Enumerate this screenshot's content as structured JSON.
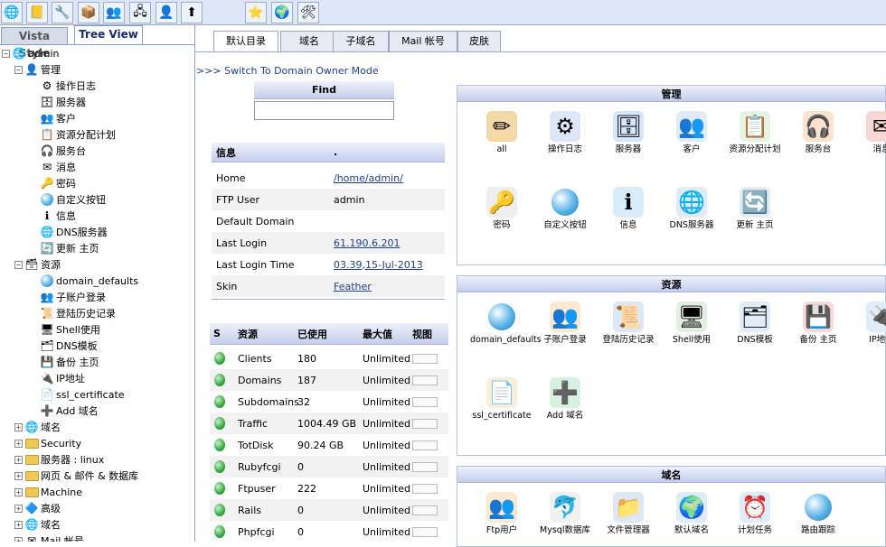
{
  "toolbar": {
    "icons": [
      "globe-person-icon",
      "notebook-icon",
      "wrench-icon",
      "cube-icon",
      "users-icon",
      "network-icon",
      "person-icon",
      "upload-icon",
      "star-icon",
      "earth-icon",
      "tools-icon"
    ]
  },
  "left": {
    "tab_vista": "Vista Style",
    "tab_tree": "Tree View",
    "tree": {
      "admin": "admin",
      "manage": "管理",
      "manage_items": [
        "操作日志",
        "服务器",
        "客户",
        "资源分配计划",
        "服务台",
        "消息",
        "密码",
        "自定义按钮",
        "信息",
        "DNS服务器",
        "更新 主页"
      ],
      "resources": "资源",
      "resource_items": [
        "domain_defaults",
        "子账户登录",
        "登陆历史记录",
        "Shell使用",
        "DNS模板",
        "备份 主页",
        "IP地址",
        "ssl_certificate",
        "Add 域名"
      ],
      "roots": [
        "域名",
        "Security",
        "服务器 : linux",
        "网页 & 邮件 & 数据库",
        "Machine",
        "高级",
        "域名",
        "Mail 帐号"
      ]
    }
  },
  "tabs": [
    "默认目录",
    "域名",
    "子域名",
    "Mail 帐号",
    "皮肤"
  ],
  "switch_link": ">>> Switch To Domain Owner Mode",
  "find": {
    "title": "Find",
    "value": ""
  },
  "info": {
    "header_key": "信息",
    "header_val": ".",
    "rows": [
      {
        "k": "Home",
        "v": "/home/admin/"
      },
      {
        "k": "FTP User",
        "v": "admin"
      },
      {
        "k": "Default Domain",
        "v": ""
      },
      {
        "k": "Last Login",
        "v": "61.190.6.201"
      },
      {
        "k": "Last Login Time",
        "v": "03.39,15-Jul-2013"
      },
      {
        "k": "Skin",
        "v": "Feather"
      }
    ]
  },
  "stats": {
    "headers": [
      "S",
      "资源",
      "已使用",
      "最大值",
      "视图"
    ],
    "rows": [
      {
        "name": "Clients",
        "used": "180",
        "max": "Unlimited"
      },
      {
        "name": "Domains",
        "used": "187",
        "max": "Unlimited"
      },
      {
        "name": "Subdomains",
        "used": "32",
        "max": "Unlimited"
      },
      {
        "name": "Traffic",
        "used": "1004.49 GB",
        "max": "Unlimited"
      },
      {
        "name": "TotDisk",
        "used": "90.24 GB",
        "max": "Unlimited"
      },
      {
        "name": "Rubyfcgi",
        "used": "0",
        "max": "Unlimited"
      },
      {
        "name": "Ftpuser",
        "used": "222",
        "max": "Unlimited"
      },
      {
        "name": "Rails",
        "used": "0",
        "max": "Unlimited"
      },
      {
        "name": "Phpfcgi",
        "used": "0",
        "max": "Unlimited"
      }
    ]
  },
  "panels": {
    "manage": {
      "title": "管理",
      "items": [
        {
          "label": "all",
          "icon": "pencil-doc-icon"
        },
        {
          "label": "操作日志",
          "icon": "gears-icon"
        },
        {
          "label": "服务器",
          "icon": "server-icon"
        },
        {
          "label": "客户",
          "icon": "clients-icon"
        },
        {
          "label": "资源分配计划",
          "icon": "plan-icon"
        },
        {
          "label": "服务台",
          "icon": "helpdesk-icon"
        },
        {
          "label": "消息",
          "icon": "message-icon"
        },
        {
          "label": "密码",
          "icon": "key-icon"
        },
        {
          "label": "自定义按钮",
          "icon": "ball-icon"
        },
        {
          "label": "信息",
          "icon": "info-icon"
        },
        {
          "label": "DNS服务器",
          "icon": "dns-icon"
        },
        {
          "label": "更新 主页",
          "icon": "refresh-icon"
        }
      ]
    },
    "resources": {
      "title": "资源",
      "items": [
        {
          "label": "domain_defaults",
          "icon": "ball-icon"
        },
        {
          "label": "子账户登录",
          "icon": "users-icon"
        },
        {
          "label": "登陆历史记录",
          "icon": "history-icon"
        },
        {
          "label": "Shell使用",
          "icon": "shell-icon"
        },
        {
          "label": "DNS模板",
          "icon": "dns-template-icon"
        },
        {
          "label": "备份 主页",
          "icon": "backup-icon"
        },
        {
          "label": "IP地址",
          "icon": "ip-icon"
        },
        {
          "label": "ssl_certificate",
          "icon": "certificate-icon"
        },
        {
          "label": "Add 域名",
          "icon": "add-domain-icon"
        }
      ]
    },
    "domains": {
      "title": "域名",
      "items": [
        {
          "label": "Ftp用户",
          "icon": "ftp-users-icon"
        },
        {
          "label": "Mysql数据库",
          "icon": "mysql-icon"
        },
        {
          "label": "文件管理器",
          "icon": "file-manager-icon"
        },
        {
          "label": "默认域名",
          "icon": "default-domain-icon"
        },
        {
          "label": "计划任务",
          "icon": "cron-icon"
        },
        {
          "label": "路由跟踪",
          "icon": "ball-icon"
        }
      ]
    }
  }
}
